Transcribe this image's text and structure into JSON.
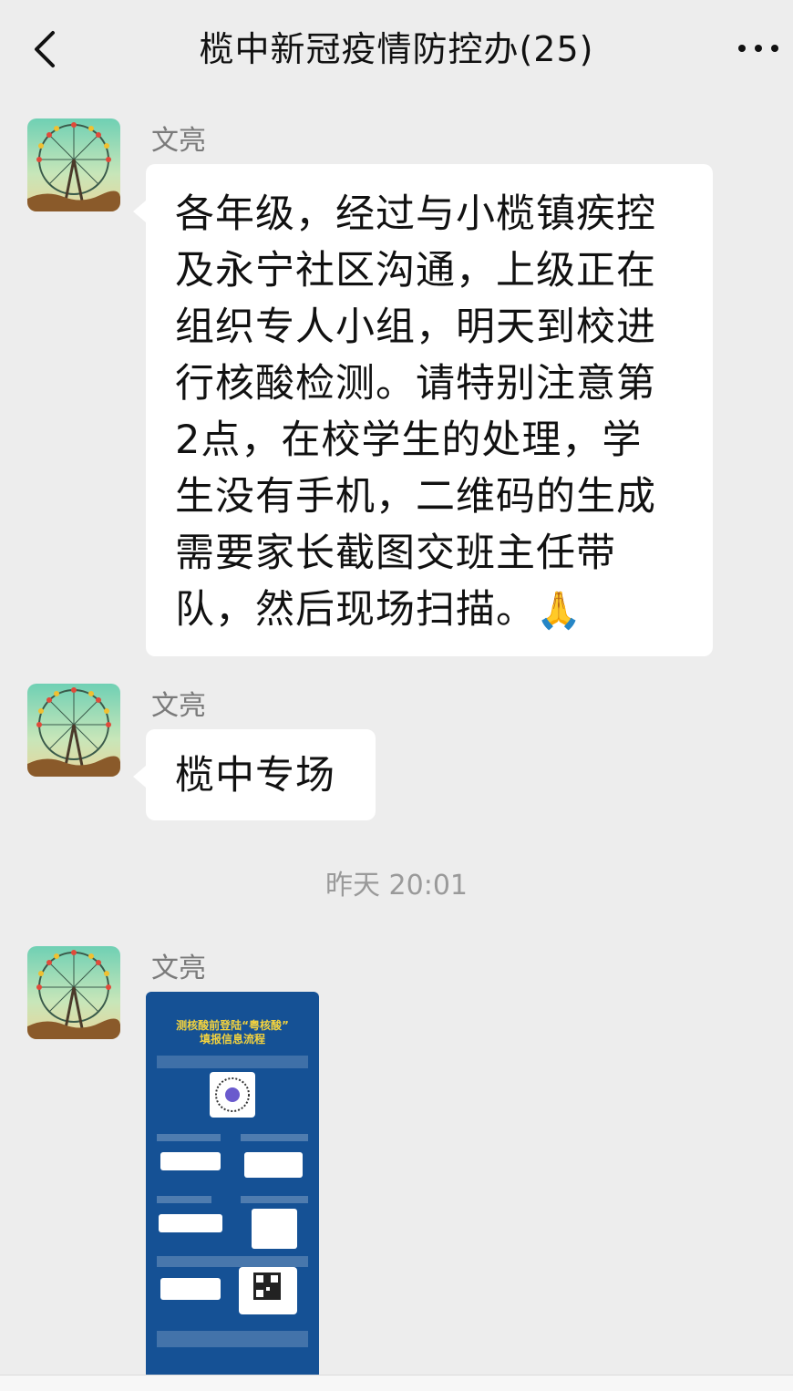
{
  "header": {
    "title": "榄中新冠疫情防控办(25)",
    "back_icon": "chevron-left-icon",
    "more_icon": "more-dots-icon"
  },
  "messages": [
    {
      "sender": "文亮",
      "text": "各年级，经过与小榄镇疾控\n及永宁社区沟通，上级正在\n组织专人小组，明天到校进\n行核酸检测。请特别注意第\n2点，在校学生的处理，学\n生没有手机，二维码的生成\n需要家长截图交班主任带\n队，然后现场扫描。",
      "emoji": "🙏"
    },
    {
      "sender": "文亮",
      "text": "榄中专场"
    }
  ],
  "timestamp": "昨天 20:01",
  "image_message": {
    "sender": "文亮",
    "poster_title_line1": "测核酸前登陆“粤核酸”",
    "poster_title_line2": "填报信息流程"
  },
  "colors": {
    "background": "#ededed",
    "bubble": "#ffffff",
    "poster_bg": "#155195",
    "poster_title": "#f3d23e"
  }
}
